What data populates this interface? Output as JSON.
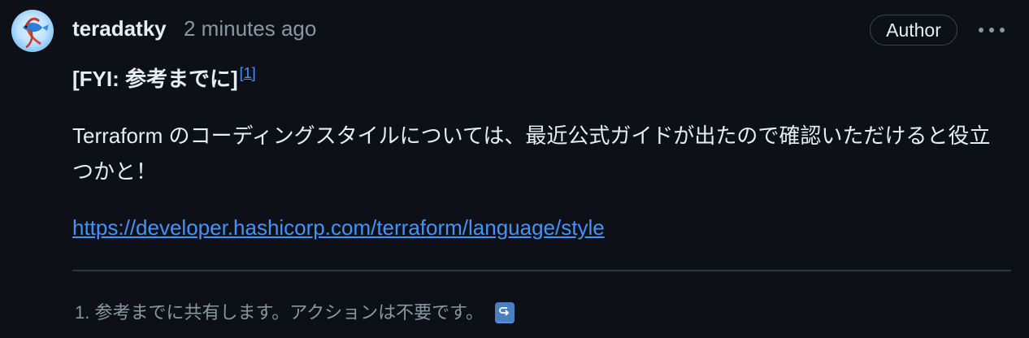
{
  "comment": {
    "author": "teradatky",
    "timestamp": "2 minutes ago",
    "badge": "Author",
    "heading": "[FYI: 参考までに]",
    "footnote_ref": "[1]",
    "body": "Terraform のコーディングスタイルについては、最近公式ガイドが出たので確認いただけると役立つかと！",
    "link": "https://developer.hashicorp.com/terraform/language/style",
    "footnote": "1. 参考までに共有します。アクションは不要です。"
  },
  "icons": {
    "avatar": "betta-fish-avatar",
    "menu": "kebab-horizontal-icon",
    "backref": "return-arrow-icon"
  },
  "colors": {
    "background": "#0d1117",
    "text": "#e6edf3",
    "muted": "#8d96a0",
    "link": "#4493f8",
    "border": "#3d444d"
  }
}
